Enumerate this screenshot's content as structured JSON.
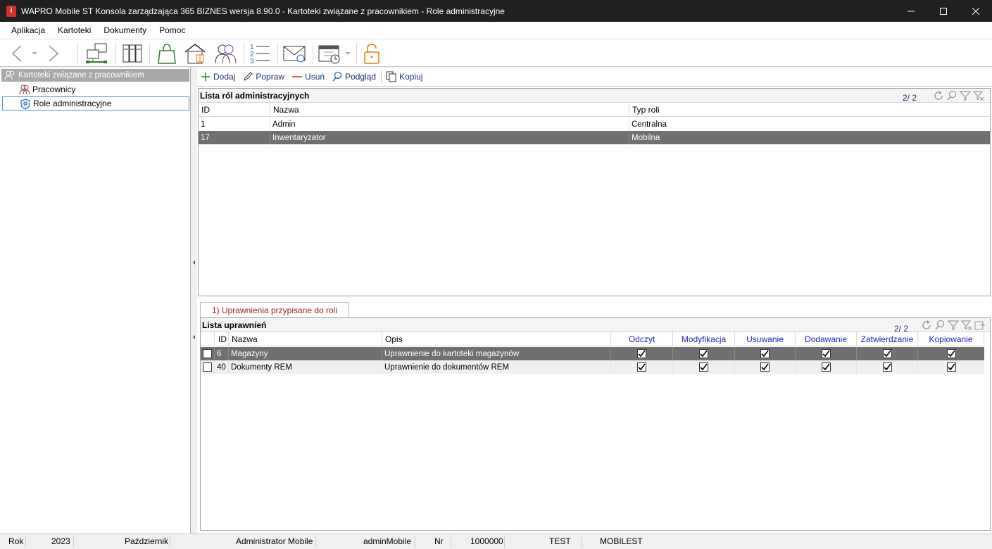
{
  "window": {
    "title": "WAPRO Mobile ST Konsola zarządzająca 365 BIZNES wersja 8.90.0 - Kartoteki związane z pracownikiem - Role administracyjne",
    "app_icon_letter": "i"
  },
  "menu": [
    "Aplikacja",
    "Kartoteki",
    "Dokumenty",
    "Pomoc"
  ],
  "toolbar_icons": [
    "back-arrow-icon",
    "forward-arrow-icon",
    "network-icon",
    "binders-icon",
    "shopping-bag-icon",
    "warehouse-icon",
    "users-icon",
    "numbered-list-icon",
    "mail-icon",
    "calendar-icon",
    "lock-icon"
  ],
  "tree": {
    "root": "Kartoteki związane z pracownikiem",
    "items": [
      "Pracownicy",
      "Role administracyjne"
    ]
  },
  "actions": {
    "add": "Dodaj",
    "edit": "Popraw",
    "delete": "Usuń",
    "preview": "Podgląd",
    "copy": "Kopiuj"
  },
  "roles_grid": {
    "title": "Lista ról administracyjnych",
    "count": "2/ 2",
    "columns": [
      "ID",
      "Nazwa",
      "Typ roli"
    ],
    "rows": [
      {
        "id": "1",
        "name": "Admin",
        "type": "Centralna"
      },
      {
        "id": "17",
        "name": "Inwentaryzator",
        "type": "Mobilna"
      }
    ],
    "selected_row": 1
  },
  "tab": {
    "label": "1) Uprawnienia przypisane do roli"
  },
  "perm_grid": {
    "title": "Lista uprawnień",
    "count": "2/ 2",
    "columns": [
      "ID",
      "Nazwa",
      "Opis",
      "Odczyt",
      "Modyfikacja",
      "Usuwanie",
      "Dodawanie",
      "Zatwierdzanie",
      "Kopiowanie"
    ],
    "rows": [
      {
        "id": "6",
        "name": "Magazyny",
        "desc": "Uprawnienie do kartoteki magazynów",
        "flags": [
          true,
          true,
          true,
          true,
          true,
          true
        ]
      },
      {
        "id": "40",
        "name": "Dokumenty REM",
        "desc": "Uprawnienie do dokumentów REM",
        "flags": [
          true,
          true,
          true,
          true,
          true,
          true
        ]
      }
    ],
    "selected_row": 0
  },
  "status": {
    "year_label": "Rok",
    "year": "2023",
    "month": "Październik",
    "user": "Administrator Mobile",
    "login": "adminMobile",
    "nr_label": "Nr",
    "nr": "1000000",
    "db": "TEST",
    "server": "MOBILEST"
  },
  "colors": {
    "titlebar": "#202020",
    "selected_row": "#707070",
    "tab_text": "#9b1c1c",
    "perm_header_text": "#2020c8",
    "action_text": "#1f2f6b"
  }
}
